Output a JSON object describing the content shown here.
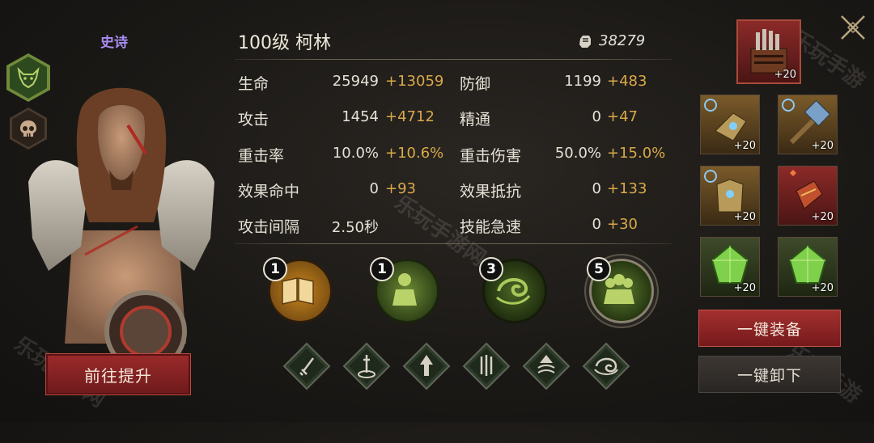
{
  "hero": {
    "rarity": "史诗",
    "name": "100级 柯林",
    "power": "38279",
    "upgrade_button": "前往提升"
  },
  "tabs": [
    {
      "icon": "beast-head-icon",
      "active": true
    },
    {
      "icon": "skull-icon",
      "active": false
    }
  ],
  "stats": {
    "left": [
      {
        "label": "生命",
        "base": "25949",
        "bonus": "+13059"
      },
      {
        "label": "攻击",
        "base": "1454",
        "bonus": "+4712"
      },
      {
        "label": "重击率",
        "base": "10.0%",
        "bonus": "+10.6%"
      },
      {
        "label": "效果命中",
        "base": "0",
        "bonus": "+93"
      },
      {
        "label": "攻击间隔",
        "base": "2.50秒",
        "bonus": ""
      }
    ],
    "right": [
      {
        "label": "防御",
        "base": "1199",
        "bonus": "+483"
      },
      {
        "label": "精通",
        "base": "0",
        "bonus": "+47"
      },
      {
        "label": "重击伤害",
        "base": "50.0%",
        "bonus": "+15.0%"
      },
      {
        "label": "效果抵抗",
        "base": "0",
        "bonus": "+133"
      },
      {
        "label": "技能急速",
        "base": "0",
        "bonus": "+30"
      }
    ]
  },
  "skills": [
    {
      "level": "1",
      "icon": "book-icon"
    },
    {
      "level": "1",
      "icon": "warrior-icon"
    },
    {
      "level": "3",
      "icon": "swirl-icon"
    },
    {
      "level": "5",
      "icon": "group-warriors-icon"
    }
  ],
  "runes": [
    "sword-icon",
    "sword-in-circle-icon",
    "arrow-up-icon",
    "triple-blade-icon",
    "wave-up-icon",
    "spiral-icon"
  ],
  "equipment": [
    {
      "slot": "top",
      "level": "+20"
    },
    {
      "slot": "r1c1",
      "level": "+20"
    },
    {
      "slot": "r1c2",
      "level": "+20"
    },
    {
      "slot": "r2c1",
      "level": "+20"
    },
    {
      "slot": "r2c2",
      "level": "+20"
    },
    {
      "slot": "r3c1",
      "level": "+20"
    },
    {
      "slot": "r3c2",
      "level": "+20"
    }
  ],
  "buttons": {
    "equip_all": "一键装备",
    "unequip_all": "一键卸下"
  },
  "watermark": "乐玩手游网"
}
